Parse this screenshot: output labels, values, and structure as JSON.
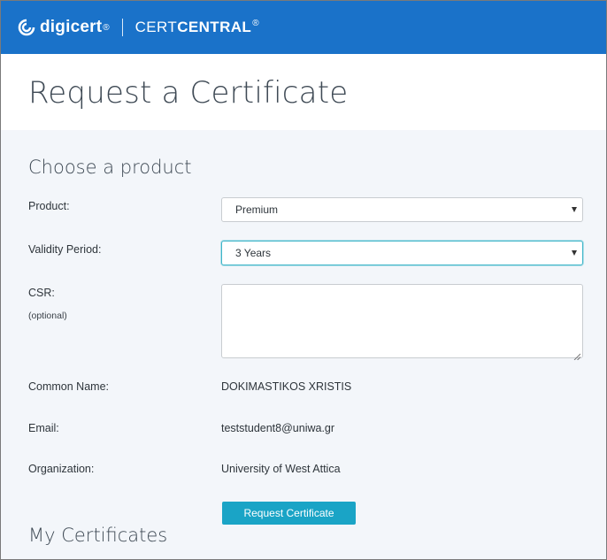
{
  "header": {
    "logo_text": "digicert",
    "logo_reg": "®",
    "brand_light": "CERT",
    "brand_bold": "CENTRAL",
    "brand_reg": "®",
    "brand_color": "#1a72c9"
  },
  "page": {
    "title": "Request a Certificate"
  },
  "choose_product": {
    "section_title": "Choose a product",
    "product_label": "Product:",
    "product_value": "Premium",
    "validity_label": "Validity Period:",
    "validity_value": "3 Years",
    "csr_label": "CSR:",
    "csr_sublabel": "(optional)",
    "csr_value": "",
    "common_name_label": "Common Name:",
    "common_name_value": "DOKIMASTIKOS XRISTIS",
    "email_label": "Email:",
    "email_value": "teststudent8@uniwa.gr",
    "organization_label": "Organization:",
    "organization_value": "University of West Attica",
    "submit_label": "Request Certificate",
    "button_color": "#1aa4c6"
  },
  "my_certificates": {
    "section_title": "My Certificates"
  }
}
